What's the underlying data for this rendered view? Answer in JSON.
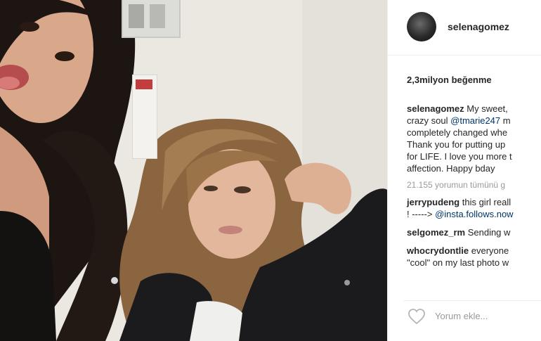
{
  "post": {
    "username": "selenagomez",
    "likes": "2,3milyon beğenme",
    "caption": {
      "username": "selenagomez",
      "line1_rest": " My sweet,",
      "line2_a": "crazy soul ",
      "line2_mention": "@tmarie247",
      "line2_b": " m",
      "line3": "completely changed whe",
      "line4": "Thank you for putting up",
      "line5": "for LIFE. I love you more t",
      "line6": "affection. Happy bday"
    },
    "view_all": "21.155 yorumun tümünü g",
    "comments": [
      {
        "username": "jerrypudeng",
        "text": " this girl reall",
        "line2_a": "! ----->",
        "line2_mention": "@insta.follows.now"
      },
      {
        "username": "selgomez_rm",
        "text": " Sending w"
      },
      {
        "username": "whocrydontlie",
        "text": " everyone",
        "line2": "\"cool\" on my last photo w"
      }
    ],
    "add_comment_placeholder": "Yorum ekle...",
    "icons": {
      "like": "heart-outline-icon"
    },
    "colors": {
      "mention": "#003569",
      "text": "#262626",
      "muted": "#999999"
    }
  }
}
